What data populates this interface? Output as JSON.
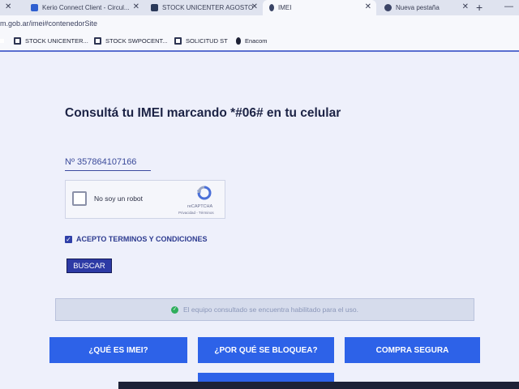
{
  "browser": {
    "tabs": [
      {
        "label": "Kerio Connect Client - Circul..."
      },
      {
        "label": "STOCK UNICENTER AGOSTO"
      },
      {
        "label": "IMEI"
      },
      {
        "label": "Nueva pestaña"
      }
    ],
    "address": "m.gob.ar/imei#contenedorSite",
    "bookmarks": [
      {
        "label": "STOCK UNICENTER..."
      },
      {
        "label": "STOCK SWPOCENT..."
      },
      {
        "label": "SOLICITUD ST"
      },
      {
        "label": "Enacom"
      }
    ],
    "colors": {
      "tab_kerio": "#2f5fd0",
      "tab_stock": "#2b3a5a",
      "tab_imei": "#3a4466",
      "tab_new": "#3b4466"
    }
  },
  "page": {
    "title": "Consultá tu IMEI marcando *#06# en tu celular",
    "imei_value": "Nº 357864107166",
    "recaptcha": {
      "label": "No soy un robot",
      "brand": "reCAPTCHA",
      "links": "Privacidad - Términos"
    },
    "terms_label": "ACEPTO TERMINOS Y CONDICIONES",
    "terms_checked": true,
    "search_button": "BUSCAR",
    "status_message": "El equipo consultado se encuentra habilitado para el uso.",
    "nav_buttons": [
      {
        "label": "¿QUÉ ES IMEI?"
      },
      {
        "label": "¿POR QUÉ SE BLOQUEA?"
      },
      {
        "label": "COMPRA SEGURA"
      }
    ],
    "accent_color": "#2d62e8",
    "success_color": "#2fae5c"
  }
}
